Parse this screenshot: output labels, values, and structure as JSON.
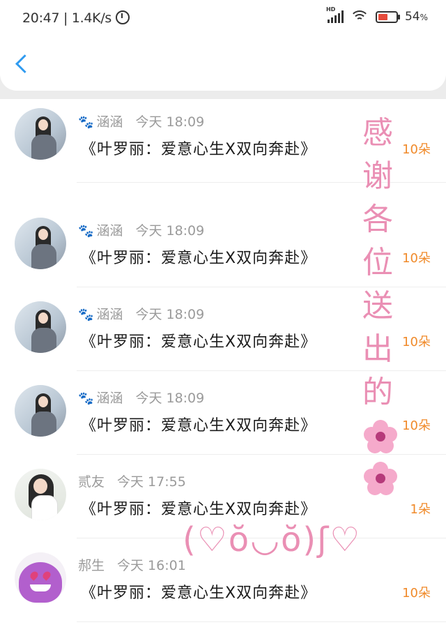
{
  "status_bar": {
    "time": "20:47",
    "network_speed": "1.4K/s",
    "network_label": "HD",
    "battery": "54"
  },
  "nav": {
    "back_icon": "chevron-left-icon"
  },
  "rows": [
    {
      "name": "涵涵",
      "time": "今天 18:09",
      "gift": "《叶罗丽：爱意心生X双向奔赴》",
      "count": "10朵",
      "paw": "🐾"
    },
    {
      "name": "涵涵",
      "time": "今天 18:09",
      "gift": "《叶罗丽：爱意心生X双向奔赴》",
      "count": "10朵",
      "paw": "🐾"
    },
    {
      "name": "涵涵",
      "time": "今天 18:09",
      "gift": "《叶罗丽：爱意心生X双向奔赴》",
      "count": "10朵",
      "paw": "🐾"
    },
    {
      "name": "涵涵",
      "time": "今天 18:09",
      "gift": "《叶罗丽：爱意心生X双向奔赴》",
      "count": "10朵",
      "paw": "🐾"
    },
    {
      "name": "贰友",
      "time": "今天 17:55",
      "gift": "《叶罗丽：爱意心生X双向奔赴》",
      "count": "1朵"
    },
    {
      "name": "郝生",
      "time": "今天 16:01",
      "gift": "《叶罗丽：爱意心生X双向奔赴》",
      "count": "10朵"
    }
  ],
  "overlay": {
    "chars": [
      "感",
      "谢",
      "各",
      "位",
      "送",
      "出",
      "的"
    ],
    "kaomoji": "(♡ŏ◡ŏ)ʃ♡"
  },
  "colors": {
    "accent": "#2f9bf0",
    "count": "#f08a2a",
    "overlay": "#ea8fb4"
  }
}
